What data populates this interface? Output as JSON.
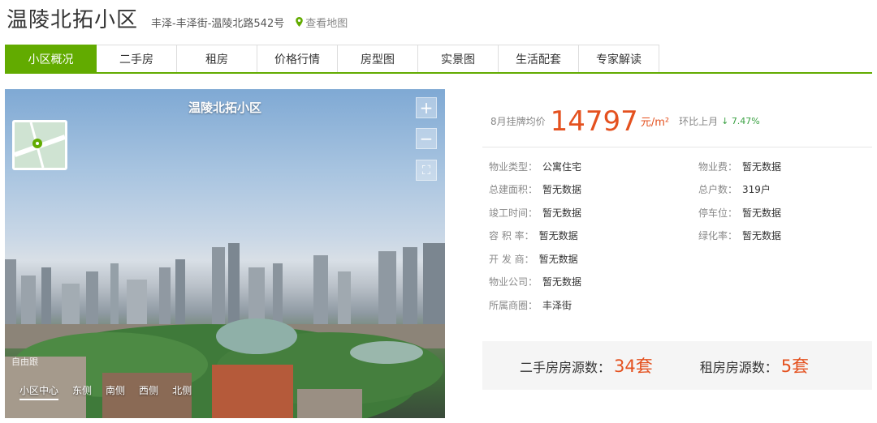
{
  "header": {
    "title": "温陵北拓小区",
    "address": "丰泽-丰泽街-温陵北路542号",
    "map_link": "查看地图"
  },
  "tabs": [
    {
      "label": "小区概况",
      "active": true
    },
    {
      "label": "二手房"
    },
    {
      "label": "租房"
    },
    {
      "label": "价格行情"
    },
    {
      "label": "房型图"
    },
    {
      "label": "实景图"
    },
    {
      "label": "生活配套"
    },
    {
      "label": "专家解读"
    }
  ],
  "panorama": {
    "title": "温陵北拓小区",
    "zoom_in": "+",
    "zoom_out": "−",
    "fullscreen": "⛶",
    "watermark": "自由跟",
    "nav": [
      "小区中心",
      "东侧",
      "南侧",
      "西侧",
      "北侧"
    ]
  },
  "price": {
    "label": "8月挂牌均价",
    "value": "14797",
    "unit": "元/m²",
    "mom_label": "环比上月",
    "mom_arrow": "↓",
    "mom_value": "7.47%"
  },
  "info": {
    "left": [
      {
        "k": "物业类型：",
        "v": "公寓住宅"
      },
      {
        "k": "总建面积：",
        "v": "暂无数据"
      },
      {
        "k": "竣工时间：",
        "v": "暂无数据"
      },
      {
        "k": "容 积 率：",
        "v": "暂无数据"
      },
      {
        "k": "开 发 商：",
        "v": "暂无数据"
      },
      {
        "k": "物业公司：",
        "v": "暂无数据"
      },
      {
        "k": "所属商圈：",
        "v": "丰泽街"
      }
    ],
    "right": [
      {
        "k": "物业费：",
        "v": "暂无数据"
      },
      {
        "k": "总户数：",
        "v": "319户"
      },
      {
        "k": "停车位：",
        "v": "暂无数据"
      },
      {
        "k": "绿化率：",
        "v": "暂无数据"
      }
    ]
  },
  "counts": {
    "second_hand_label": "二手房房源数：",
    "second_hand_value": "34套",
    "rent_label": "租房房源数：",
    "rent_value": "5套"
  },
  "colors": {
    "accent": "#62ab00",
    "price": "#e4511f",
    "down": "#3aa142"
  }
}
